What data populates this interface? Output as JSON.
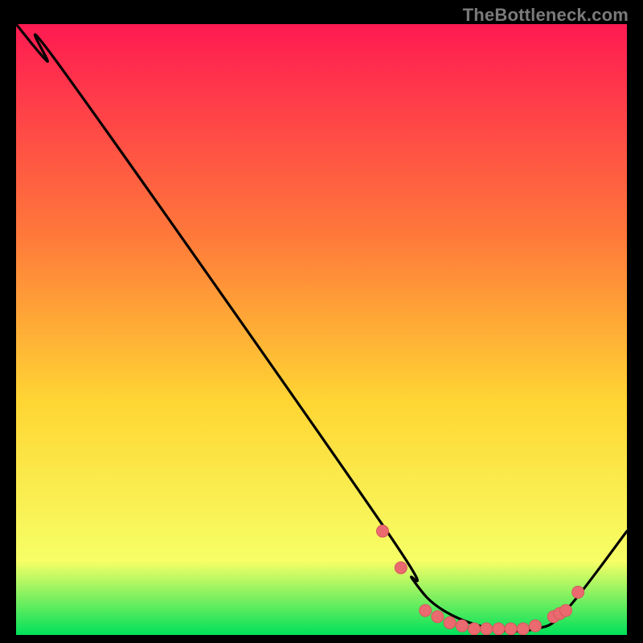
{
  "watermark": "TheBottleneck.com",
  "colors": {
    "bg_outer": "#000000",
    "gradient_top": "#ff1a52",
    "gradient_mid1": "#ff7a3a",
    "gradient_mid2": "#ffd633",
    "gradient_mid3": "#f6ff66",
    "gradient_bottom": "#00e05a",
    "curve": "#000000",
    "marker_fill": "#eb6a6f",
    "marker_stroke": "#d4585d"
  },
  "chart_data": {
    "type": "line",
    "title": "",
    "xlabel": "",
    "ylabel": "",
    "xlim": [
      0,
      100
    ],
    "ylim": [
      0,
      100
    ],
    "curve": {
      "name": "bottleneck-curve",
      "x": [
        0,
        5,
        8,
        60,
        65,
        70,
        78,
        85,
        90,
        100
      ],
      "y": [
        100,
        94,
        92,
        18,
        9,
        4,
        1,
        1,
        4,
        17
      ]
    },
    "markers": {
      "name": "highlighted-points",
      "points": [
        {
          "x": 60,
          "y": 17
        },
        {
          "x": 63,
          "y": 11
        },
        {
          "x": 67,
          "y": 4
        },
        {
          "x": 69,
          "y": 3
        },
        {
          "x": 71,
          "y": 2
        },
        {
          "x": 73,
          "y": 1.5
        },
        {
          "x": 75,
          "y": 1
        },
        {
          "x": 77,
          "y": 1
        },
        {
          "x": 79,
          "y": 1
        },
        {
          "x": 81,
          "y": 1
        },
        {
          "x": 83,
          "y": 1
        },
        {
          "x": 85,
          "y": 1.5
        },
        {
          "x": 88,
          "y": 3
        },
        {
          "x": 89,
          "y": 3.5
        },
        {
          "x": 90,
          "y": 4
        },
        {
          "x": 92,
          "y": 7
        }
      ]
    }
  }
}
